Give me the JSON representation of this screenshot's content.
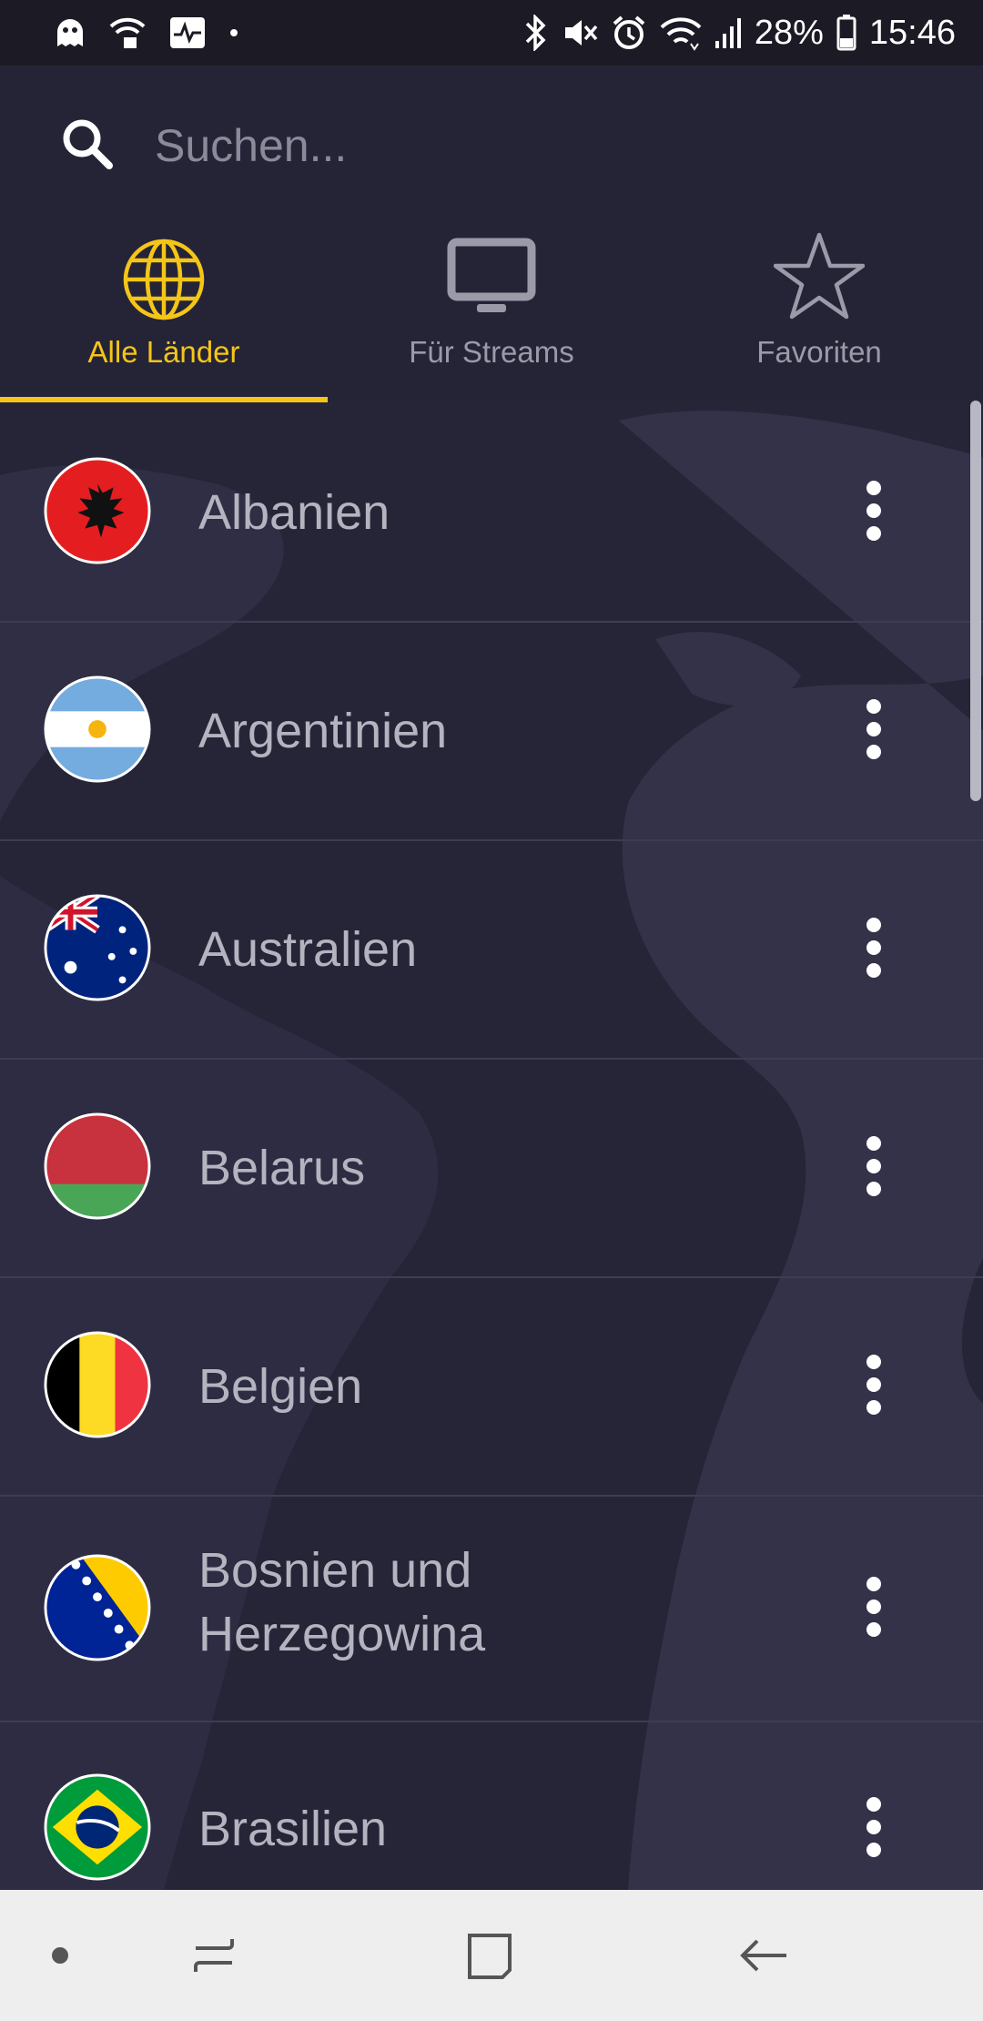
{
  "status_bar": {
    "battery": "28%",
    "time": "15:46"
  },
  "search": {
    "placeholder": "Suchen..."
  },
  "tabs": [
    {
      "label": "Alle Länder",
      "icon": "globe-icon",
      "active": true
    },
    {
      "label": "Für Streams",
      "icon": "tv-icon",
      "active": false
    },
    {
      "label": "Favoriten",
      "icon": "star-icon",
      "active": false
    }
  ],
  "countries": [
    {
      "name": "Albanien",
      "flag": "albania-flag-icon"
    },
    {
      "name": "Argentinien",
      "flag": "argentina-flag-icon"
    },
    {
      "name": "Australien",
      "flag": "australia-flag-icon"
    },
    {
      "name": "Belarus",
      "flag": "belarus-flag-icon"
    },
    {
      "name": "Belgien",
      "flag": "belgium-flag-icon"
    },
    {
      "name_line1": "Bosnien und",
      "name_line2": "Herzegowina",
      "flag": "bosnia-flag-icon"
    },
    {
      "name": "Brasilien",
      "flag": "brazil-flag-icon"
    }
  ],
  "colors": {
    "accent": "#f5c518",
    "background": "#252437",
    "text": "#b4b4c0"
  }
}
